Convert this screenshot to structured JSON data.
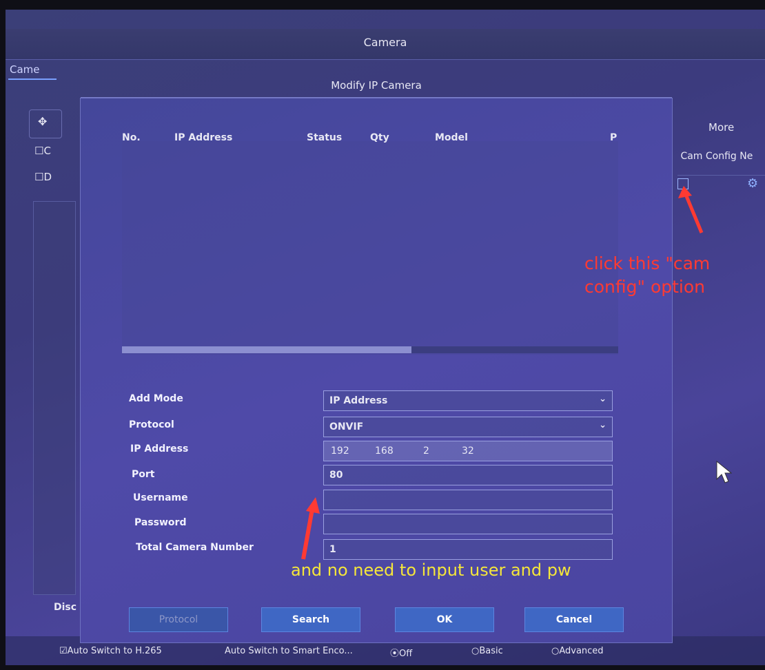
{
  "window": {
    "title": "Camera"
  },
  "background": {
    "tab_label": "Came",
    "row1_label": "☐C",
    "row2_label": "☐D",
    "more_label": "More",
    "cam_config_header": " Cam Config Ne",
    "disc_label": "Disc",
    "edit_icon": "edit-icon",
    "gear_icon": "gear-icon"
  },
  "dialog": {
    "title": "Modify IP Camera",
    "table": {
      "columns": [
        "No.",
        "IP Address",
        "Status",
        "Qty",
        "Model",
        "P"
      ],
      "rows": []
    },
    "form": {
      "add_mode": {
        "label": "Add Mode",
        "value": "IP Address"
      },
      "protocol": {
        "label": "Protocol",
        "value": "ONVIF"
      },
      "ip_address": {
        "label": "IP Address",
        "octets": [
          "192",
          "168",
          "2",
          "32"
        ]
      },
      "port": {
        "label": "Port",
        "value": "80"
      },
      "username": {
        "label": "Username",
        "value": ""
      },
      "password": {
        "label": "Password",
        "value": ""
      },
      "total_camera_number": {
        "label": "Total Camera Number",
        "value": "1"
      }
    },
    "buttons": {
      "protocol": "Protocol",
      "search": "Search",
      "ok": "OK",
      "cancel": "Cancel"
    }
  },
  "bottom_bar": {
    "auto_switch_h265": "☑Auto Switch to H.265",
    "auto_switch_smart": "Auto Switch to Smart Enco...",
    "off": "⦿Off",
    "basic": "○Basic",
    "advanced": "○Advanced"
  },
  "annotations": {
    "red_note": "click this \"cam config\" option",
    "yellow_note": "and no need to input user and pw"
  },
  "colors": {
    "annotation_red": "#ff3a32",
    "annotation_yellow": "#f5e63a",
    "button_blue": "#3f67c4",
    "dialog_bg": "#4a45a0"
  }
}
